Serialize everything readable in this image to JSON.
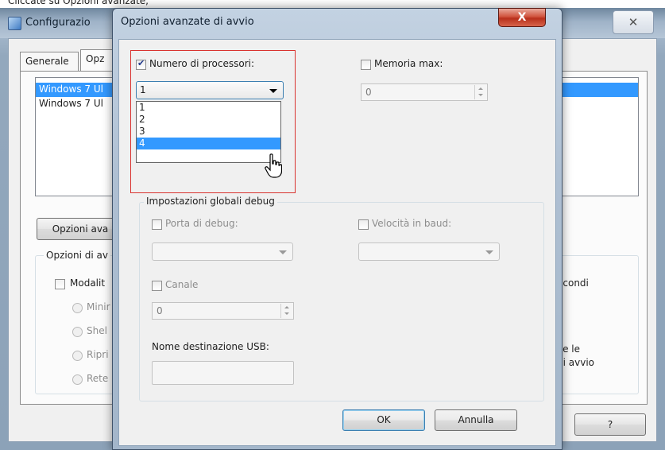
{
  "caption": "Cliccate su Opzioni avanzate,",
  "background_window": {
    "title": "Configurazio",
    "close_glyph": "✕",
    "tabs": [
      "Generale",
      "Opz"
    ],
    "os_list": [
      "Windows 7 Ul",
      "Windows 7 Ul"
    ],
    "advanced_button": "Opzioni ava",
    "boot_options_label": "Opzioni di av",
    "safe_mode_label": "Modalit",
    "radio_options": [
      "Minir",
      "Shel",
      "Ripri",
      "Rete"
    ],
    "right_text_1": "econdi",
    "right_text_2": "ve le",
    "right_text_3": "di avvio",
    "help_button": "?"
  },
  "dialog": {
    "title": "Opzioni avanzate di avvio",
    "close_glyph": "X",
    "num_processors_label": "Numero di processori:",
    "num_processors_checked": true,
    "num_processors_value": "1",
    "processor_options": [
      "1",
      "2",
      "3",
      "4"
    ],
    "highlighted_option": "4",
    "max_memory_label": "Memoria max:",
    "max_memory_value": "0",
    "debug_group_label": "Impostazioni globali debug",
    "debug_port_label": "Porta di debug:",
    "baud_rate_label": "Velocità in baud:",
    "channel_label": "Canale",
    "channel_value": "0",
    "usb_target_label": "Nome destinazione USB:",
    "ok_button": "OK",
    "cancel_button": "Annulla"
  },
  "colors": {
    "highlight": "#3399ff",
    "red_box": "#d9332f",
    "close_button_red": "#c8412b"
  }
}
